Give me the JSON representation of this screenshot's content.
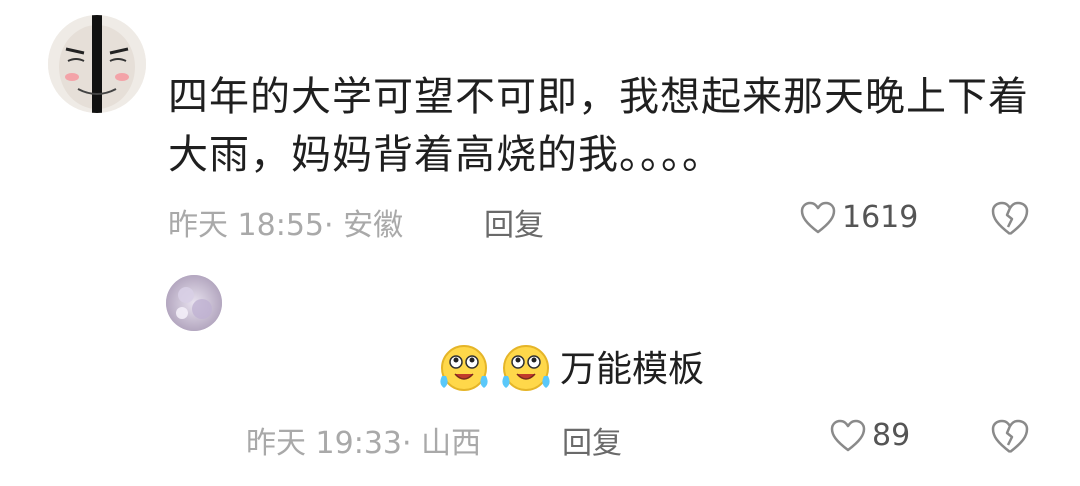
{
  "comment": {
    "text": "四年的大学可望不可即，我想起来那天晚上下着大雨，妈妈背着高烧的我。。。。",
    "time_location": "昨天 18:55· 安徽",
    "reply_label": "回复",
    "like_count": "1619"
  },
  "reply": {
    "text": "万能模板",
    "time_location": "昨天 19:33· 山西",
    "reply_label": "回复",
    "like_count": "89",
    "emoji_icons": [
      "crying-laughing-emoji-icon",
      "crying-laughing-emoji-icon"
    ]
  },
  "colors": {
    "text": "#1f1f1f",
    "meta": "#a9a9a9",
    "reply_link": "#6a6a6a",
    "icon": "#8a8a8a"
  }
}
